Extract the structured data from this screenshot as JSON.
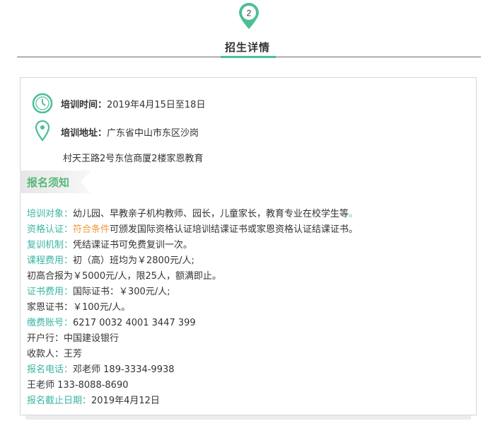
{
  "header": {
    "step_number": "2",
    "title": "招生详情"
  },
  "info": {
    "time_label": "培训时间：",
    "time_value": "2019年4月15日至18日",
    "address_label": "培训地址：",
    "address_line1": "广东省中山市东区沙岗",
    "address_line2": "村天王路2号东信商厦2楼家恩教育"
  },
  "notice": {
    "tag": "报名须知",
    "target_label": "培训对象：",
    "target_value": "幼儿园、早教亲子机构教师、园长，儿童家长，教育专业在校学生等",
    "target_dot": "。",
    "cert_label": "资格认证：",
    "cert_highlight": "符合条件",
    "cert_value": "可颁发国际资格认证培训结课证书或家恩资格认证结课证书。",
    "retrain_label": "复训机制：",
    "retrain_value": "凭结课证书可免费复训一次。",
    "fee_label": "课程费用：",
    "fee_value1": "初（高）班均为￥2800元/人;",
    "fee_value2": "初高合报为￥5000元/人，限25人，额满即止。",
    "certfee_label": "证书费用：",
    "certfee_value1": "国际证书：￥300元/人;",
    "certfee_value2": "家恩证书：￥100元/人。",
    "account_label": "缴费账号：",
    "account_value": "6217 0032 4001 3447 399",
    "bank": "开户行：中国建设银行",
    "payee": "收款人：王芳",
    "phone_label": "报名电话：",
    "phone_value1": "邓老师 189-3334-9938",
    "phone_value2": "王老师 133-8088-8690",
    "deadline_label": "报名截止日期：",
    "deadline_value": "2019年4月12日"
  },
  "colors": {
    "accent": "#4cbf95",
    "label_teal": "#3ab5a4",
    "highlight_orange": "#f09a3e",
    "tag_green": "#55b87a"
  }
}
